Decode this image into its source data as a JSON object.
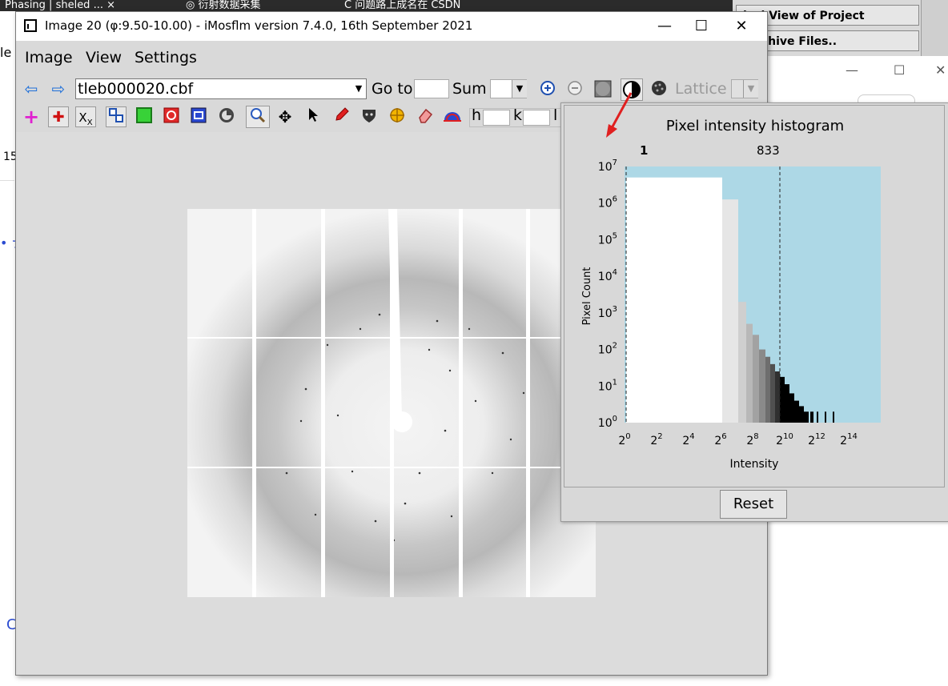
{
  "background": {
    "tabs": [
      "Phasing | sheled ... ×",
      "◎ 衍射数据采集",
      "C 问题路上成名在 CSDN"
    ],
    "right_buttons": [
      "ical View of Project",
      "/Archive Files.."
    ],
    "left_fragments": [
      "le",
      "15",
      "• ナ",
      "C"
    ]
  },
  "window": {
    "title": "Image 20 (φ:9.50-10.00) - iMosflm version 7.4.0, 16th September 2021",
    "minimize": "—",
    "maximize": "☐",
    "close": "✕"
  },
  "menu": [
    "Image",
    "View",
    "Settings"
  ],
  "toolbar1": {
    "file": "tleb000020.cbf",
    "goto_label": "Go to",
    "sum_label": "Sum",
    "lattice_label": "Lattice"
  },
  "toolbar2": {
    "h_label": "h",
    "k_label": "k",
    "l_label": "l"
  },
  "histogram": {
    "title": "Pixel intensity histogram",
    "low_value": "1",
    "high_value": "833",
    "xlabel": "Intensity",
    "ylabel": "Pixel Count",
    "reset_label": "Reset",
    "colors": {
      "plot_bg": "#add8e6",
      "arrow": "#e02020"
    }
  },
  "chart_data": {
    "type": "bar",
    "title": "Pixel intensity histogram",
    "xlabel": "Intensity",
    "ylabel": "Pixel Count",
    "x_scale": "log2",
    "y_scale": "log10",
    "x_ticks": [
      "2^0",
      "2^2",
      "2^4",
      "2^6",
      "2^8",
      "2^10",
      "2^12",
      "2^14"
    ],
    "y_ticks": [
      "10^0",
      "10^1",
      "10^2",
      "10^3",
      "10^4",
      "10^5",
      "10^6",
      "10^7"
    ],
    "xlim_exp2": [
      0,
      16
    ],
    "ylim_exp10": [
      0,
      7
    ],
    "low_marker_exp2": 0,
    "high_marker_exp2": 9.7,
    "bins": [
      {
        "x0": 0.1,
        "x1": 6.1,
        "log_count": 6.7,
        "shade": "#ffffff"
      },
      {
        "x0": 6.1,
        "x1": 7.1,
        "log_count": 6.1,
        "shade": "#e6e6e6"
      },
      {
        "x0": 7.1,
        "x1": 7.6,
        "log_count": 3.3,
        "shade": "#cfcfcf"
      },
      {
        "x0": 7.6,
        "x1": 8.0,
        "log_count": 2.7,
        "shade": "#b8b8b8"
      },
      {
        "x0": 8.0,
        "x1": 8.4,
        "log_count": 2.4,
        "shade": "#a2a2a2"
      },
      {
        "x0": 8.4,
        "x1": 8.8,
        "log_count": 2.0,
        "shade": "#8a8a8a"
      },
      {
        "x0": 8.8,
        "x1": 9.1,
        "log_count": 1.8,
        "shade": "#6e6e6e"
      },
      {
        "x0": 9.1,
        "x1": 9.4,
        "log_count": 1.6,
        "shade": "#505050"
      },
      {
        "x0": 9.4,
        "x1": 9.7,
        "log_count": 1.4,
        "shade": "#303030"
      },
      {
        "x0": 9.7,
        "x1": 10.0,
        "log_count": 1.25,
        "shade": "#000000"
      },
      {
        "x0": 10.0,
        "x1": 10.3,
        "log_count": 1.05,
        "shade": "#000000"
      },
      {
        "x0": 10.3,
        "x1": 10.6,
        "log_count": 0.8,
        "shade": "#000000"
      },
      {
        "x0": 10.6,
        "x1": 10.9,
        "log_count": 0.6,
        "shade": "#000000"
      },
      {
        "x0": 10.9,
        "x1": 11.2,
        "log_count": 0.45,
        "shade": "#000000"
      },
      {
        "x0": 11.2,
        "x1": 11.5,
        "log_count": 0.3,
        "shade": "#000000"
      },
      {
        "x0": 11.6,
        "x1": 11.8,
        "log_count": 0.3,
        "shade": "#000000"
      },
      {
        "x0": 12.0,
        "x1": 12.1,
        "log_count": 0.3,
        "shade": "#000000"
      },
      {
        "x0": 12.5,
        "x1": 12.6,
        "log_count": 0.3,
        "shade": "#000000"
      },
      {
        "x0": 13.0,
        "x1": 13.1,
        "log_count": 0.3,
        "shade": "#000000"
      }
    ]
  }
}
